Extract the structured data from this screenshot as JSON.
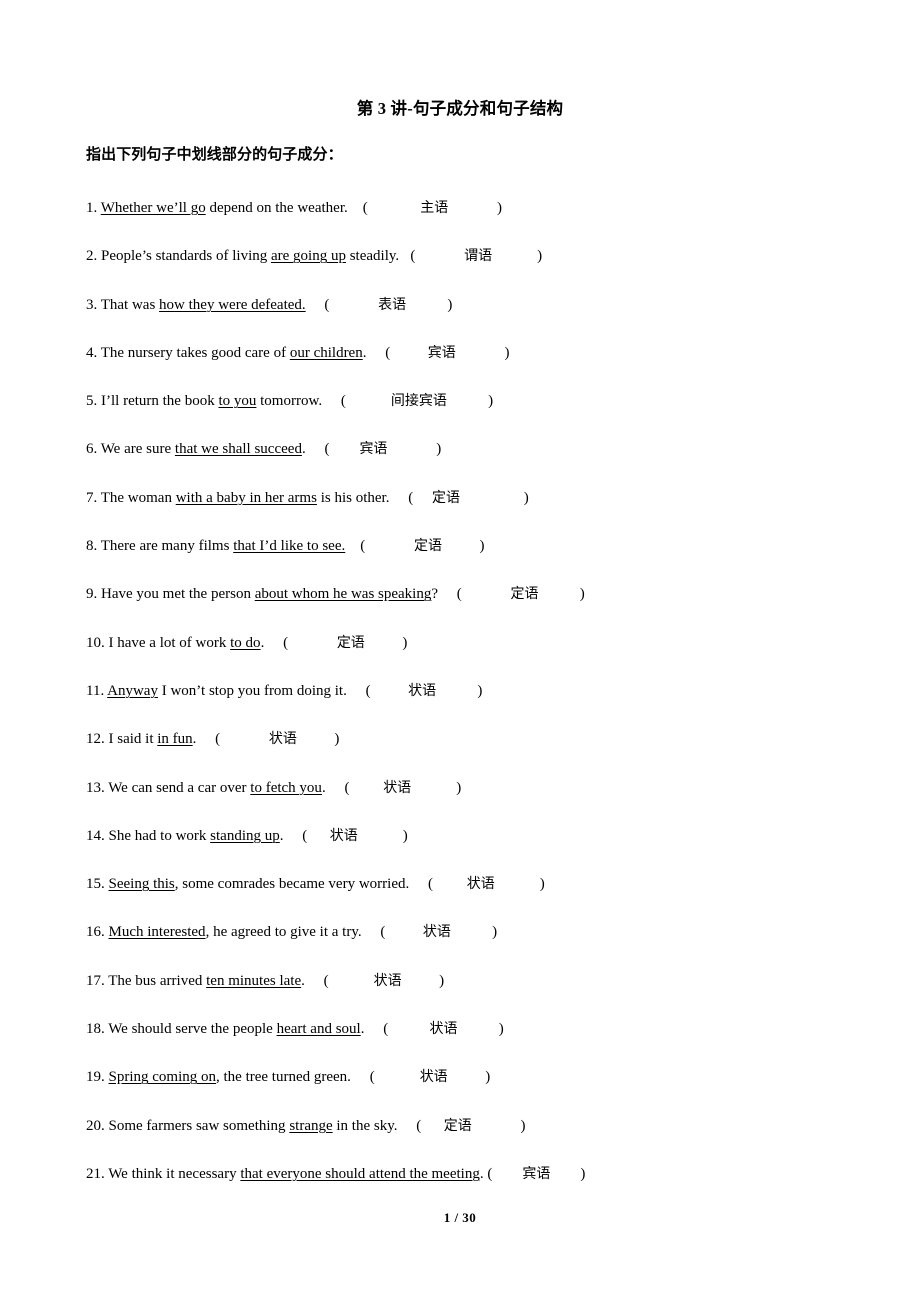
{
  "document": {
    "title": "第 3 讲-句子成分和句子结构",
    "instruction": "指出下列句子中划线部分的句子成分：",
    "footer": "1 / 30"
  },
  "questions": [
    {
      "number": "1.",
      "before": " ",
      "underlined": "Whether we’ll go",
      "after": " depend on the weather.",
      "gap1": "    ",
      "open_paren": "(",
      "pad_left": "              ",
      "answer": "主语",
      "pad_right": "             ",
      "close_paren": ")"
    },
    {
      "number": "2.",
      "before": " People’s standards of living ",
      "underlined": "are going up",
      "after": " steadily.",
      "gap1": "   ",
      "open_paren": "(",
      "pad_left": "             ",
      "answer": "谓语",
      "pad_right": "            ",
      "close_paren": ")"
    },
    {
      "number": "3.",
      "before": " That was ",
      "underlined": "how they were defeated.",
      "after": "",
      "gap1": "     ",
      "open_paren": "(",
      "pad_left": "             ",
      "answer": "表语",
      "pad_right": "           ",
      "close_paren": ")"
    },
    {
      "number": "4.",
      "before": " The nursery takes good care of ",
      "underlined": "our children",
      "after": ".",
      "gap1": "     ",
      "open_paren": "(",
      "pad_left": "          ",
      "answer": "宾语",
      "pad_right": "             ",
      "close_paren": ")"
    },
    {
      "number": "5.",
      "before": " I’ll return the book ",
      "underlined": "to you",
      "after": " tomorrow.",
      "gap1": "     ",
      "open_paren": "(",
      "pad_left": "            ",
      "answer": "间接宾语",
      "pad_right": "           ",
      "close_paren": ")"
    },
    {
      "number": "6.",
      "before": " We are sure ",
      "underlined": "that we shall succeed",
      "after": ".",
      "gap1": "     ",
      "open_paren": "(",
      "pad_left": "        ",
      "answer": "宾语",
      "pad_right": "             ",
      "close_paren": ")"
    },
    {
      "number": "7.",
      "before": " The woman ",
      "underlined": "with a baby in her arms",
      "after": " is his other.",
      "gap1": "     ",
      "open_paren": "(",
      "pad_left": "     ",
      "answer": "定语",
      "pad_right": "                 ",
      "close_paren": ")"
    },
    {
      "number": "8.",
      "before": " There are many films ",
      "underlined": "that I’d like to see.",
      "after": "",
      "gap1": "    ",
      "open_paren": "(",
      "pad_left": "             ",
      "answer": "定语",
      "pad_right": "          ",
      "close_paren": ")"
    },
    {
      "number": "9.",
      "before": " Have you met the person ",
      "underlined": "about whom he was speaking",
      "after": "?",
      "gap1": "     ",
      "open_paren": "(",
      "pad_left": "             ",
      "answer": "定语",
      "pad_right": "           ",
      "close_paren": ")"
    },
    {
      "number": "10.",
      "before": " I have a lot of work ",
      "underlined": "to do",
      "after": ".",
      "gap1": "     ",
      "open_paren": "(",
      "pad_left": "             ",
      "answer": "定语",
      "pad_right": "          ",
      "close_paren": ")"
    },
    {
      "number": "11.",
      "before": " ",
      "underlined": "Anyway",
      "after": " I won’t stop you from doing it.",
      "gap1": "     ",
      "open_paren": "(",
      "pad_left": "          ",
      "answer": "状语",
      "pad_right": "           ",
      "close_paren": ")"
    },
    {
      "number": "12.",
      "before": " I said it ",
      "underlined": "in fun",
      "after": ".",
      "gap1": "     ",
      "open_paren": "(",
      "pad_left": "             ",
      "answer": "状语",
      "pad_right": "          ",
      "close_paren": ")"
    },
    {
      "number": "13.",
      "before": " We can send a car over ",
      "underlined": "to fetch you",
      "after": ".",
      "gap1": "     ",
      "open_paren": "(",
      "pad_left": "         ",
      "answer": "状语",
      "pad_right": "            ",
      "close_paren": ")"
    },
    {
      "number": "14.",
      "before": " She had to work ",
      "underlined": "standing up",
      "after": ".",
      "gap1": "     ",
      "open_paren": "(",
      "pad_left": "      ",
      "answer": "状语",
      "pad_right": "            ",
      "close_paren": ")"
    },
    {
      "number": "15.",
      "before": " ",
      "underlined": "Seeing this",
      "after": ", some comrades became very worried.",
      "gap1": "     ",
      "open_paren": "(",
      "pad_left": "         ",
      "answer": "状语",
      "pad_right": "            ",
      "close_paren": ")"
    },
    {
      "number": "16.",
      "before": " ",
      "underlined": "Much interested",
      "after": ", he agreed to give it a try.",
      "gap1": "     ",
      "open_paren": "(",
      "pad_left": "          ",
      "answer": "状语",
      "pad_right": "           ",
      "close_paren": ")"
    },
    {
      "number": "17.",
      "before": " The bus arrived ",
      "underlined": "ten minutes late",
      "after": ".",
      "gap1": "     ",
      "open_paren": "(",
      "pad_left": "            ",
      "answer": "状语",
      "pad_right": "          ",
      "close_paren": ")"
    },
    {
      "number": "18.",
      "before": " We should serve the people ",
      "underlined": "heart and soul",
      "after": ".",
      "gap1": "     ",
      "open_paren": "(",
      "pad_left": "           ",
      "answer": "状语",
      "pad_right": "           ",
      "close_paren": ")"
    },
    {
      "number": "19.",
      "before": " ",
      "underlined": "Spring coming on",
      "after": ", the tree turned green.",
      "gap1": "     ",
      "open_paren": "(",
      "pad_left": "            ",
      "answer": "状语",
      "pad_right": "          ",
      "close_paren": ")"
    },
    {
      "number": "20.",
      "before": " Some farmers saw something ",
      "underlined": "strange",
      "after": " in the sky.",
      "gap1": "     ",
      "open_paren": "(",
      "pad_left": "      ",
      "answer": "定语",
      "pad_right": "             ",
      "close_paren": ")"
    },
    {
      "number": "21.",
      "before": " We think it necessary ",
      "underlined": "that everyone should attend the meeting",
      "after": ".",
      "gap1": " ",
      "open_paren": "(",
      "pad_left": "        ",
      "answer": "宾语",
      "pad_right": "        ",
      "close_paren": ")"
    }
  ]
}
